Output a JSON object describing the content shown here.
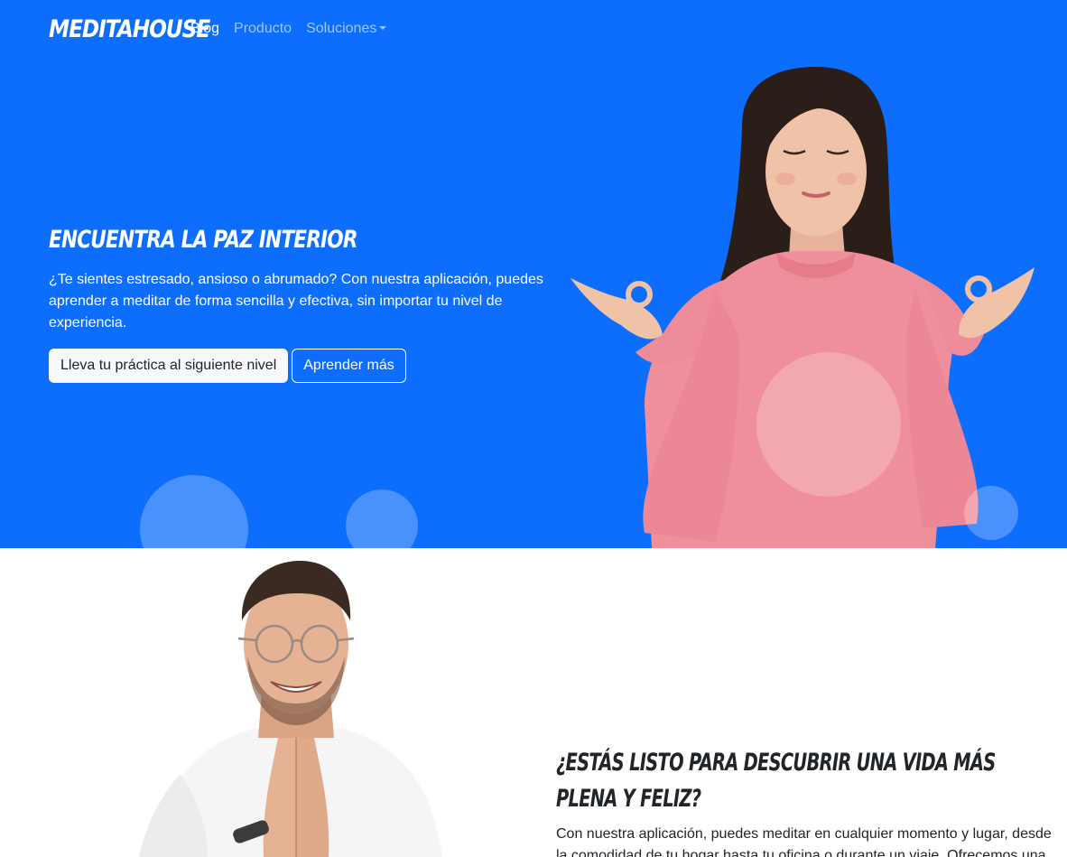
{
  "navbar": {
    "brand": "MEDITAHOUSE",
    "links": [
      {
        "label": "Blog",
        "active": true
      },
      {
        "label": "Producto",
        "active": false
      },
      {
        "label": "Soluciones",
        "active": false,
        "dropdown": true
      }
    ]
  },
  "hero": {
    "title": "ENCUENTRA LA PAZ INTERIOR",
    "text": "¿Te sientes estresado, ansioso o abrumado? Con nuestra aplicación, puedes aprender a meditar de forma sencilla y efectiva, sin importar tu nivel de experiencia.",
    "primary_button": "Lleva tu práctica al siguiente nivel",
    "secondary_button": "Aprender más",
    "background_color": "#0d6efd"
  },
  "section2": {
    "title": "¿ESTÁS LISTO PARA DESCUBRIR UNA VIDA MÁS PLENA Y FELIZ?",
    "text": "Con nuestra aplicación, puedes meditar en cualquier momento y lugar, desde la comodidad de tu hogar hasta tu oficina o durante un viaje. Ofrecemos una"
  }
}
